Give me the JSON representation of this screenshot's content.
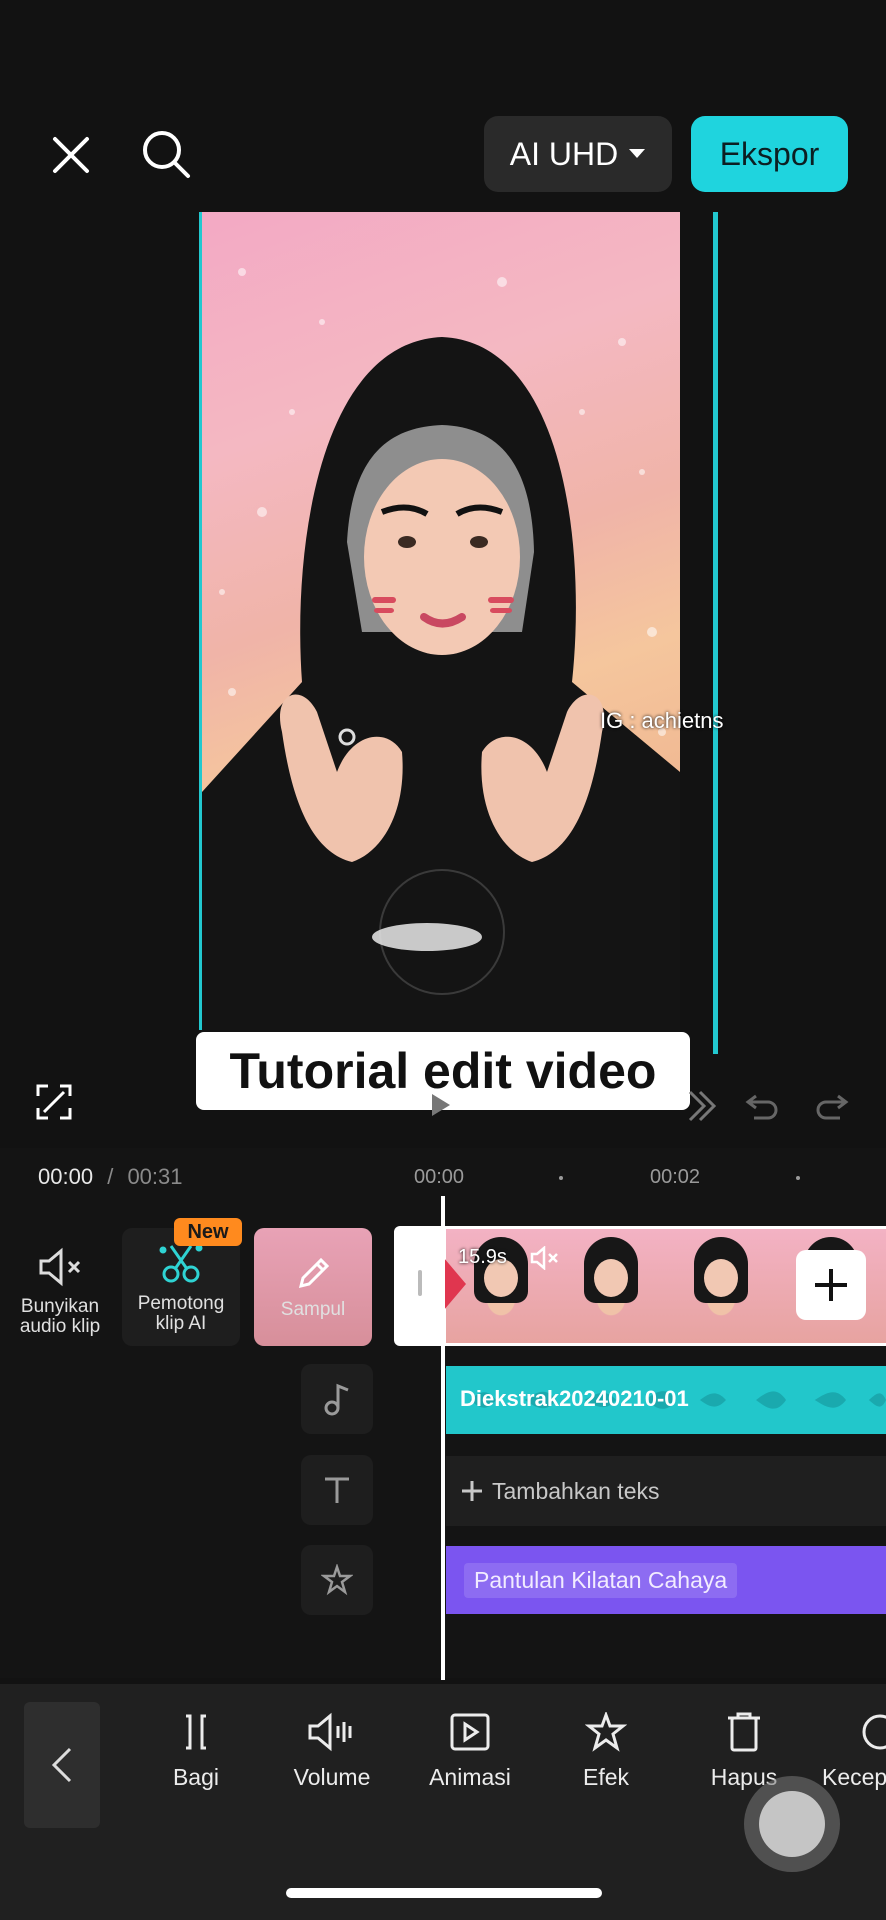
{
  "top_bar": {
    "quality_label": "AI UHD",
    "export_label": "Ekspor"
  },
  "preview": {
    "caption": "Tutorial edit video",
    "watermark": "IG : achietns"
  },
  "timeline": {
    "current_time": "00:00",
    "separator": "/",
    "total_time": "00:31",
    "ruler_labels": [
      "00:00",
      "00:02"
    ],
    "left_tools": {
      "mute_label": "Bunyikan audio klip",
      "ai_cut_label": "Pemotong klip AI",
      "new_badge": "New",
      "cover_label": "Sampul"
    },
    "video_clip": {
      "duration": "15.9s"
    },
    "audio_clip": {
      "label": "Diekstrak20240210-01"
    },
    "text_track": {
      "label": "Tambahkan teks"
    },
    "effect_clip": {
      "label": "Pantulan Kilatan Cahaya"
    }
  },
  "toolbar": {
    "items": [
      {
        "label": "Bagi",
        "icon": "split-icon"
      },
      {
        "label": "Volume",
        "icon": "volume-icon"
      },
      {
        "label": "Animasi",
        "icon": "animation-icon"
      },
      {
        "label": "Efek",
        "icon": "effect-icon"
      },
      {
        "label": "Hapus",
        "icon": "delete-icon"
      },
      {
        "label": "Kecep",
        "icon": "speed-icon"
      }
    ]
  },
  "colors": {
    "accent": "#1fd4de",
    "effect": "#7b55f0",
    "audio": "#1aa9ae",
    "badge": "#ff8a1e"
  }
}
